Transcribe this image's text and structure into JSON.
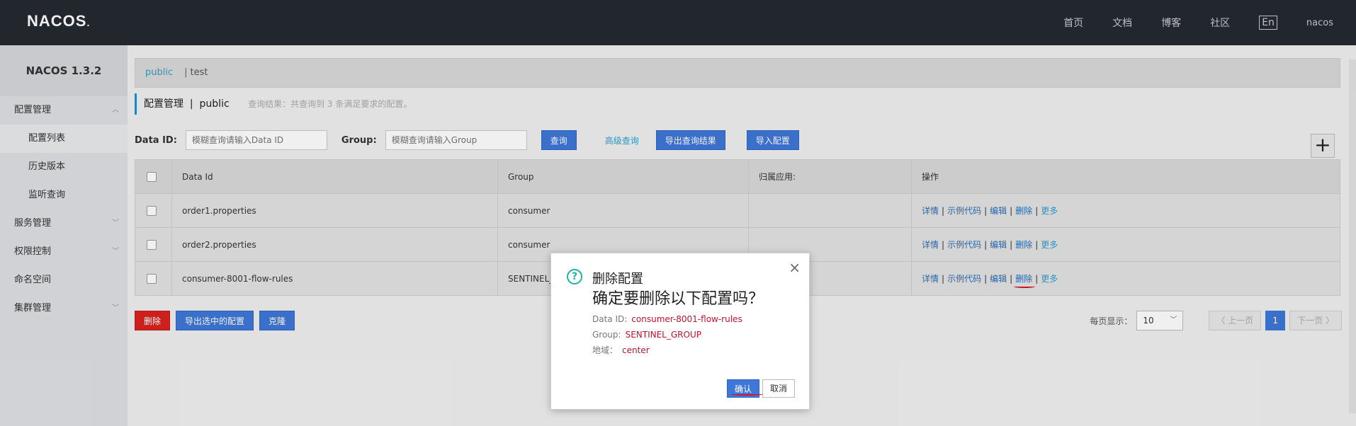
{
  "brand": {
    "logo": "NACOS",
    "logo_dot": "."
  },
  "topnav": {
    "items": [
      "首页",
      "文档",
      "博客",
      "社区"
    ],
    "lang": "En",
    "user": "nacos"
  },
  "sidebar": {
    "brand": "NACOS 1.3.2",
    "items": [
      {
        "label": "配置管理",
        "chevron": "︿"
      },
      {
        "label": "配置列表"
      },
      {
        "label": "历史版本"
      },
      {
        "label": "监听查询"
      },
      {
        "label": "服务管理",
        "chevron": "﹀"
      },
      {
        "label": "权限控制",
        "chevron": "﹀"
      },
      {
        "label": "命名空间"
      },
      {
        "label": "集群管理",
        "chevron": "﹀"
      }
    ]
  },
  "namespace": {
    "active": "public",
    "sep": "|",
    "other": "test"
  },
  "page": {
    "title": "配置管理",
    "sep": "|",
    "ns": "public",
    "hint": "查询结果：共查询到 3 条满足要求的配置。"
  },
  "filter": {
    "dataid_label": "Data ID:",
    "dataid_placeholder": "模糊查询请输入Data ID",
    "group_label": "Group:",
    "group_placeholder": "模糊查询请输入Group",
    "search": "查询",
    "advanced": "高级查询",
    "export_result": "导出查询结果",
    "import": "导入配置",
    "plus": "+"
  },
  "table": {
    "headers": [
      "Data Id",
      "Group",
      "归属应用:",
      "操作"
    ],
    "rows": [
      {
        "dataid": "order1.properties",
        "group": "consumer",
        "app": ""
      },
      {
        "dataid": "order2.properties",
        "group": "consumer",
        "app": ""
      },
      {
        "dataid": "consumer-8001-flow-rules",
        "group": "SENTINEL_",
        "app": ""
      }
    ],
    "ops": {
      "detail": "详情",
      "sample": "示例代码",
      "edit": "编辑",
      "delete": "删除",
      "more": "更多",
      "sep": "|"
    }
  },
  "bottom": {
    "delete": "删除",
    "export_selected": "导出选中的配置",
    "clone": "克隆"
  },
  "pager": {
    "label": "每页显示：",
    "size": "10",
    "chevron": "﹀",
    "prev": "〈 上一页",
    "page": "1",
    "next": "下一页 〉"
  },
  "dialog": {
    "title": "删除配置",
    "question": "确定要删除以下配置吗？",
    "icon": "?",
    "close": "×",
    "rows": [
      {
        "k": "Data ID:",
        "v": "consumer-8001-flow-rules"
      },
      {
        "k": "Group:",
        "v": "SENTINEL_GROUP"
      },
      {
        "k": "地域：",
        "v": "center"
      }
    ],
    "ok": "确认",
    "cancel": "取消"
  }
}
